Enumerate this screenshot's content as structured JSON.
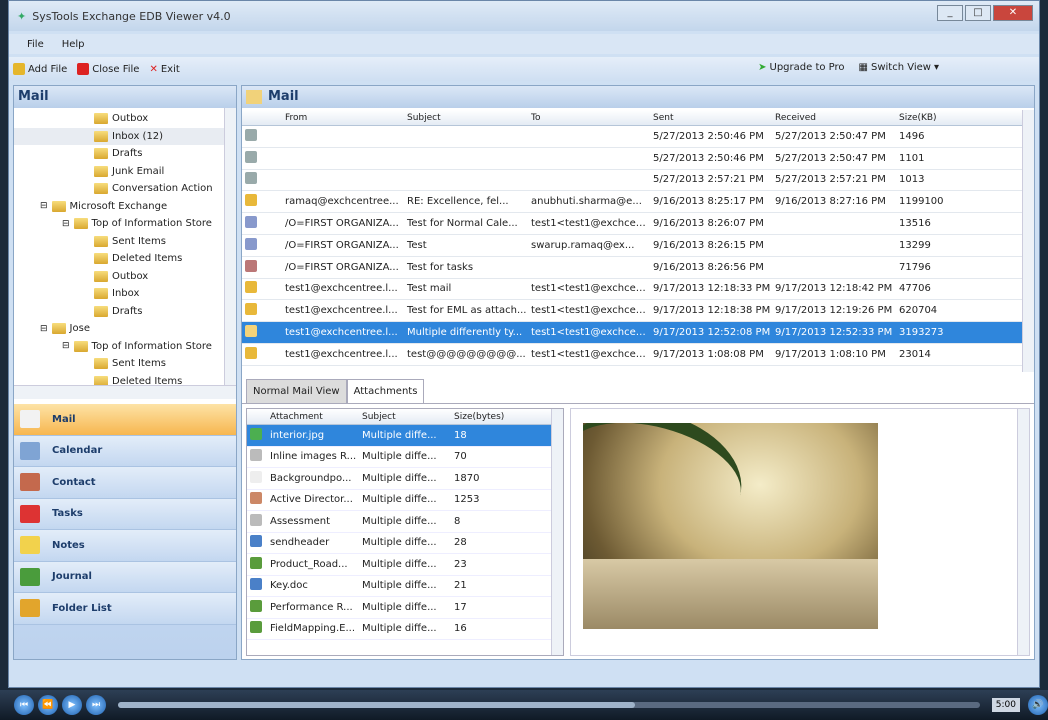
{
  "window": {
    "title": "SysTools Exchange EDB Viewer v4.0"
  },
  "menu": [
    "File",
    "Help"
  ],
  "toolbar": {
    "add_file": "Add File",
    "close_file": "Close File",
    "exit": "Exit",
    "upgrade": "Upgrade to Pro",
    "switch_view": "Switch View"
  },
  "left": {
    "header": "Mail",
    "tree": [
      {
        "label": "Outbox",
        "indent": 80
      },
      {
        "label": "Inbox (12)",
        "indent": 80,
        "selected": true
      },
      {
        "label": "Drafts",
        "indent": 80
      },
      {
        "label": "Junk Email",
        "indent": 80
      },
      {
        "label": "Conversation Action",
        "indent": 80
      },
      {
        "label": "Microsoft Exchange",
        "indent": 26,
        "expander": "⊟"
      },
      {
        "label": "Top of Information Store",
        "indent": 48,
        "expander": "⊟"
      },
      {
        "label": "Sent Items",
        "indent": 80
      },
      {
        "label": "Deleted Items",
        "indent": 80
      },
      {
        "label": "Outbox",
        "indent": 80
      },
      {
        "label": "Inbox",
        "indent": 80
      },
      {
        "label": "Drafts",
        "indent": 80
      },
      {
        "label": "Jose",
        "indent": 26,
        "expander": "⊟"
      },
      {
        "label": "Top of Information Store",
        "indent": 48,
        "expander": "⊟"
      },
      {
        "label": "Sent Items",
        "indent": 80
      },
      {
        "label": "Deleted Items",
        "indent": 80
      }
    ],
    "nav": [
      {
        "label": "Mail",
        "color": "#f2f2f2",
        "active": true
      },
      {
        "label": "Calendar",
        "color": "#7fa4d4"
      },
      {
        "label": "Contact",
        "color": "#c4694d"
      },
      {
        "label": "Tasks",
        "color": "#d33"
      },
      {
        "label": "Notes",
        "color": "#f2d24c"
      },
      {
        "label": "Journal",
        "color": "#4a9c3c"
      },
      {
        "label": "Folder List",
        "color": "#e2a52c"
      }
    ]
  },
  "mail": {
    "header": "Mail",
    "columns": [
      "From",
      "Subject",
      "To",
      "Sent",
      "Received",
      "Size(KB)"
    ],
    "rows": [
      {
        "icon": "#9aa",
        "from": "",
        "subject": "",
        "to": "",
        "sent": "5/27/2013 2:50:46 PM",
        "received": "5/27/2013 2:50:47 PM",
        "size": "1496"
      },
      {
        "icon": "#9aa",
        "from": "",
        "subject": "",
        "to": "",
        "sent": "5/27/2013 2:50:46 PM",
        "received": "5/27/2013 2:50:47 PM",
        "size": "1101"
      },
      {
        "icon": "#9aa",
        "from": "",
        "subject": "",
        "to": "",
        "sent": "5/27/2013 2:57:21 PM",
        "received": "5/27/2013 2:57:21 PM",
        "size": "1013"
      },
      {
        "icon": "#e8b83a",
        "from": "ramaq@exchcentree...",
        "subject": "RE: Excellence, fel...",
        "to": "anubhuti.sharma@e...",
        "sent": "9/16/2013 8:25:17 PM",
        "received": "9/16/2013 8:27:16 PM",
        "size": "1199100"
      },
      {
        "icon": "#8899cc",
        "from": "/O=FIRST ORGANIZA...",
        "subject": "Test for Normal Cale...",
        "to": "test1<test1@exchcen...",
        "sent": "9/16/2013 8:26:07 PM",
        "received": "",
        "size": "13516"
      },
      {
        "icon": "#8899cc",
        "from": "/O=FIRST ORGANIZA...",
        "subject": "Test",
        "to": "swarup.ramaq@ex...",
        "sent": "9/16/2013 8:26:15 PM",
        "received": "",
        "size": "13299"
      },
      {
        "icon": "#b77",
        "from": "/O=FIRST ORGANIZA...",
        "subject": "Test for tasks",
        "to": "",
        "sent": "9/16/2013 8:26:56 PM",
        "received": "",
        "size": "71796"
      },
      {
        "icon": "#e8b83a",
        "from": "test1@exchcentree.l...",
        "subject": "Test mail",
        "to": "test1<test1@exchcen...",
        "sent": "9/17/2013 12:18:33 PM",
        "received": "9/17/2013 12:18:42 PM",
        "size": "47706"
      },
      {
        "icon": "#e8b83a",
        "from": "test1@exchcentree.l...",
        "subject": "Test for EML as attach...",
        "to": "test1<test1@exchcen...",
        "sent": "9/17/2013 12:18:38 PM",
        "received": "9/17/2013 12:19:26 PM",
        "size": "620704"
      },
      {
        "icon": "#f4d37a",
        "from": "test1@exchcentree.l...",
        "subject": "Multiple differently ty...",
        "to": "test1<test1@exchcen...",
        "sent": "9/17/2013 12:52:08 PM",
        "received": "9/17/2013 12:52:33 PM",
        "size": "3193273",
        "selected": true
      },
      {
        "icon": "#e8b83a",
        "from": "test1@exchcentree.l...",
        "subject": "test@@@@@@@@@...",
        "to": "test1<test1@exchcen...",
        "sent": "9/17/2013 1:08:08 PM",
        "received": "9/17/2013 1:08:10 PM",
        "size": "23014"
      }
    ]
  },
  "tabs": [
    "Normal Mail View",
    "Attachments"
  ],
  "attachments": {
    "columns": [
      "Attachment",
      "Subject",
      "Size(bytes)"
    ],
    "rows": [
      {
        "icon": "#4caf50",
        "name": "interior.jpg",
        "subject": "Multiple diffe...",
        "size": "18",
        "selected": true
      },
      {
        "icon": "#bbb",
        "name": "Inline images R...",
        "subject": "Multiple diffe...",
        "size": "70"
      },
      {
        "icon": "#eee",
        "name": "Backgroundpo...",
        "subject": "Multiple diffe...",
        "size": "1870"
      },
      {
        "icon": "#c86",
        "name": "Active Director...",
        "subject": "Multiple diffe...",
        "size": "1253"
      },
      {
        "icon": "#bbb",
        "name": "Assessment",
        "subject": "Multiple diffe...",
        "size": "8"
      },
      {
        "icon": "#4a80c8",
        "name": "sendheader",
        "subject": "Multiple diffe...",
        "size": "28"
      },
      {
        "icon": "#5a9c3c",
        "name": "Product_Road...",
        "subject": "Multiple diffe...",
        "size": "23"
      },
      {
        "icon": "#4a80c8",
        "name": "Key.doc",
        "subject": "Multiple diffe...",
        "size": "21"
      },
      {
        "icon": "#5a9c3c",
        "name": "Performance R...",
        "subject": "Multiple diffe...",
        "size": "17"
      },
      {
        "icon": "#5a9c3c",
        "name": "FieldMapping.E...",
        "subject": "Multiple diffe...",
        "size": "16"
      }
    ]
  },
  "player": {
    "time": "5:00",
    "progress": 0.6
  }
}
